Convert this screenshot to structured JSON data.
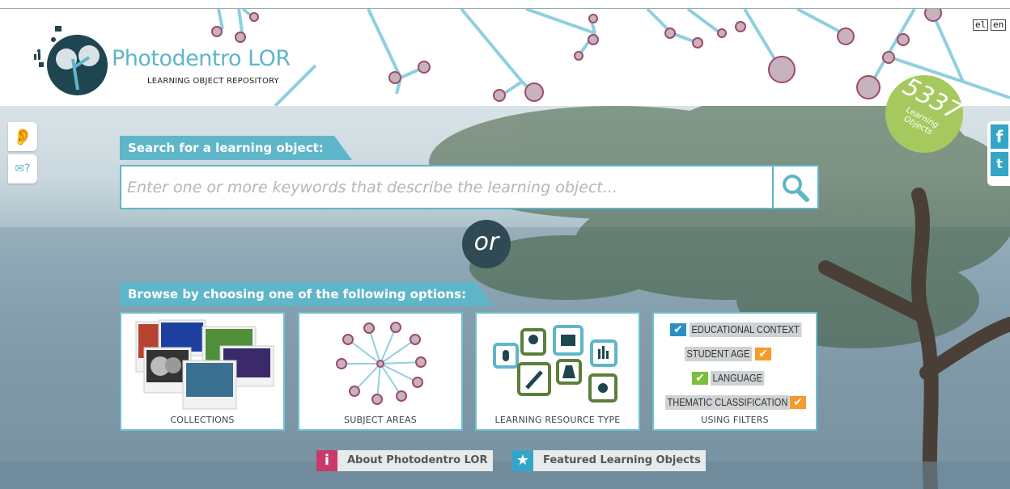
{
  "header": {
    "logo_title": "Photodentro LOR",
    "logo_subtitle": "LEARNING OBJECT REPOSITORY",
    "languages": [
      "el",
      "en"
    ]
  },
  "counter": {
    "number": "5337",
    "label_line1": "Learning",
    "label_line2": "Objects"
  },
  "side_tabs": [
    "accessibility-icon",
    "feedback-icon"
  ],
  "social": [
    "facebook-icon",
    "twitter-icon"
  ],
  "search": {
    "heading": "Search for a learning object:",
    "placeholder": "Enter one or more keywords that describe the learning object...",
    "button_icon": "search-icon"
  },
  "or_label": "or",
  "browse": {
    "heading": "Browse by choosing one of the following options:",
    "cards": [
      {
        "label": "COLLECTIONS"
      },
      {
        "label": "SUBJECT AREAS"
      },
      {
        "label": "LEARNING RESOURCE TYPE"
      },
      {
        "label": "USING FILTERS"
      }
    ],
    "filters": [
      "EDUCATIONAL CONTEXT",
      "STUDENT AGE",
      "LANGUAGE",
      "THEMATIC CLASSIFICATION"
    ]
  },
  "footer_links": [
    {
      "icon": "i",
      "label": "About Photodentro LOR",
      "color": "#c73a6a"
    },
    {
      "icon": "★",
      "label": "Featured Learning Objects",
      "color": "#33a6c8"
    }
  ],
  "colors": {
    "accent": "#5fb6c8",
    "dark": "#1f4650",
    "green": "#a6c95f",
    "orange": "#f39b2b",
    "filter_blue": "#2b8fc6",
    "filter_green": "#7cbf3c"
  }
}
